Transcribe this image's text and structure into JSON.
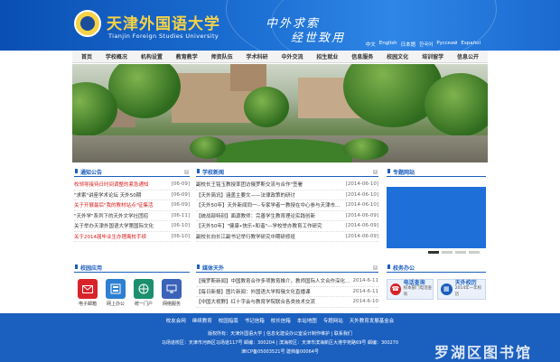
{
  "header": {
    "school_name": "天津外国语大学",
    "school_name_en": "Tianjin Foreign Studies University",
    "slogan_line1": "中外求索",
    "slogan_line2": "经世致用",
    "languages": [
      "中文",
      "English",
      "日本語",
      "한국어",
      "Русский",
      "Español"
    ]
  },
  "nav": {
    "items": [
      "首页",
      "学校概况",
      "机构设置",
      "教育教学",
      "师资队伍",
      "学术科研",
      "中外交流",
      "招生就业",
      "信息服务",
      "校园文化",
      "培训留学",
      "信息公开"
    ]
  },
  "notices": {
    "title": "通知公告",
    "items": [
      {
        "text": "校领导接待日时间调整的紧急通知",
        "date": "[06-09]",
        "red": true
      },
      {
        "text": "\"求索\"讲座学术论坛 天外50期",
        "date": "[06-09]",
        "red": false
      },
      {
        "text": "关于开展最后\"我的教材站点\"征集活",
        "date": "[06-09]",
        "red": true
      },
      {
        "text": "\"天外学\"系列下的天外文学社团招",
        "date": "[06-11]",
        "red": false
      },
      {
        "text": "关于举办天津外国语大学第国际文化",
        "date": "[06-10]",
        "red": false
      },
      {
        "text": "关于2014届毕业生办理离校手续",
        "date": "[06-10]",
        "red": true
      }
    ]
  },
  "school_news": {
    "title": "学校新闻",
    "items": [
      {
        "text": "副校长王铭玉教授率团访俄罗斯交流与合作\"签署",
        "date": "[2014-06-10]"
      },
      {
        "text": "【天外简讯】涵盖主要文——法律政策的研讨",
        "date": "[2014-06-10]"
      },
      {
        "text": "【天外50年】天外新闻同一--专家学者一教授在中心参与天津市教育",
        "date": "[2014-06-10]"
      },
      {
        "text": "【统战部特别】面源教师：完善学生教育理论实践创新",
        "date": "[2014-06-09]"
      },
      {
        "text": "【天外50年】\"健康•快乐•和谐\"—学校举办教育工作研究",
        "date": "[2014-06-09]"
      },
      {
        "text": "副校长向长江副书记举行教学研究中期研修班",
        "date": "[2014-06-09]"
      }
    ]
  },
  "features": {
    "title": "专题网站",
    "dots": [
      true,
      false,
      false,
      false
    ]
  },
  "campus_apps": {
    "title": "校园应用",
    "items": [
      {
        "label": "电子邮箱",
        "color": "#d8232a"
      },
      {
        "label": "网上办公",
        "color": "#2d7fd1"
      },
      {
        "label": "统一门户",
        "color": "#1c8f6f"
      },
      {
        "label": "网络服务",
        "color": "#3a62b8"
      }
    ]
  },
  "media": {
    "title": "媒体天外",
    "items": [
      {
        "text": "【俄罗斯新闻】中国教育合作多项教育推介，教师国际人文合作深化交流内容与此前的合作",
        "date": "2014-6-11"
      },
      {
        "text": "【每日新报】图片新闻：外国语大学和俄文化直播课",
        "date": "2014-6-11"
      },
      {
        "text": "【中国大视野】红十字会与教育学院联合各类技术交流",
        "date": "2014-6-10"
      }
    ]
  },
  "services": {
    "title": "校务办公",
    "items": [
      {
        "title": "电话查询",
        "sub": "校本部门电话查询",
        "icon": "☎"
      },
      {
        "title": "天外校历",
        "sub": "2014年一年校历",
        "icon": "▦"
      }
    ]
  },
  "footer": {
    "links": [
      "校友会网",
      "继续教育",
      "校园指南",
      "书记信箱",
      "校长信箱",
      "本站地图",
      "专题网站",
      "天外教育发展基金会"
    ],
    "line1": "版权所有：天津外国语大学 | 信息化建设办公室设计制作维护 | 联系我们",
    "line2": "马场道校区：天津市河西区马场道117号 邮编：300204 | 滨海校区：天津市滨海新区大港学苑路69号 邮编：300270",
    "line3": "津ICP备05003521号     建档备00064号",
    "watermark": "罗湖区图书馆"
  }
}
